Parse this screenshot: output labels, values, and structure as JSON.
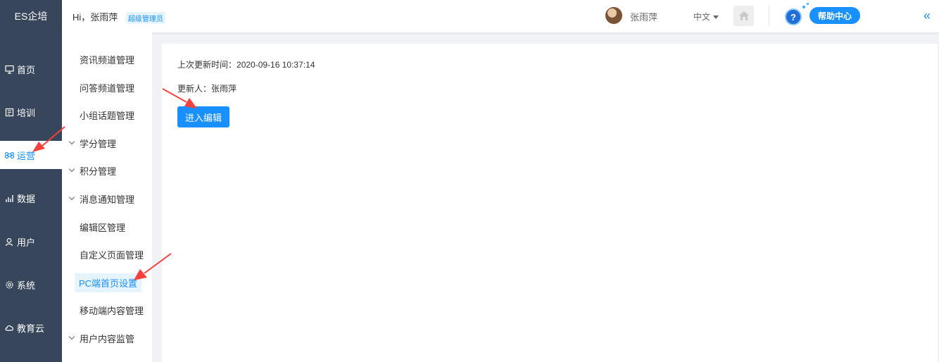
{
  "brand": {
    "name": "ES企培"
  },
  "header": {
    "greeting": "Hi，张雨萍",
    "role_badge": "超级管理员",
    "user_name": "张雨萍",
    "language": "中文",
    "help_label": "帮助中心",
    "help_q": "?",
    "collapse_glyph": "«"
  },
  "sidebar": {
    "items": [
      {
        "label": "首页",
        "icon": "monitor-icon"
      },
      {
        "label": "培训",
        "icon": "book-icon"
      },
      {
        "label": "运营",
        "icon": "command-icon",
        "active": true
      },
      {
        "label": "数据",
        "icon": "bar-chart-icon"
      },
      {
        "label": "用户",
        "icon": "user-icon"
      },
      {
        "label": "系统",
        "icon": "gear-icon"
      },
      {
        "label": "教育云",
        "icon": "cloud-icon"
      }
    ]
  },
  "submenu": {
    "items": [
      {
        "label": "资讯频道管理",
        "type": "leaf"
      },
      {
        "label": "问答频道管理",
        "type": "leaf"
      },
      {
        "label": "小组话题管理",
        "type": "leaf"
      },
      {
        "label": "学分管理",
        "type": "group"
      },
      {
        "label": "积分管理",
        "type": "group"
      },
      {
        "label": "消息通知管理",
        "type": "group"
      },
      {
        "label": "编辑区管理",
        "type": "leaf"
      },
      {
        "label": "自定义页面管理",
        "type": "leaf"
      },
      {
        "label": "PC端首页设置",
        "type": "leaf",
        "active": true
      },
      {
        "label": "移动端内容管理",
        "type": "leaf"
      },
      {
        "label": "用户内容监管",
        "type": "group"
      }
    ]
  },
  "content": {
    "last_update_label": "上次更新时间：",
    "last_update_value": "2020-09-16 10:37:14",
    "updater_label": "更新人：",
    "updater_value": "张雨萍",
    "edit_button": "进入编辑"
  },
  "colors": {
    "accent": "#1890ff",
    "sidebar_bg": "#38465b",
    "annotation": "#f5413d"
  }
}
